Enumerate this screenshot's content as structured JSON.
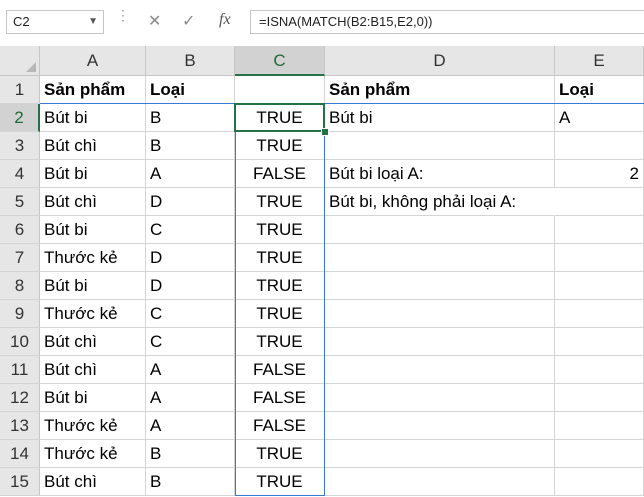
{
  "formula_bar": {
    "name_box": "C2",
    "cancel_icon": "cancel-icon",
    "enter_icon": "checkmark-icon",
    "fx_label": "fx",
    "formula": "=ISNA(MATCH(B2:B15,E2,0))"
  },
  "columns": [
    "A",
    "B",
    "C",
    "D",
    "E"
  ],
  "rows": [
    "1",
    "2",
    "3",
    "4",
    "5",
    "6",
    "7",
    "8",
    "9",
    "10",
    "11",
    "12",
    "13",
    "14",
    "15"
  ],
  "cells": {
    "A1": "Sản phẩm",
    "B1": "Loại",
    "C1": "",
    "D1": "Sản phẩm",
    "E1": "Loại",
    "A2": "Bút bi",
    "B2": "B",
    "C2": "TRUE",
    "D2": "Bút bi",
    "E2": "A",
    "A3": "Bút chì",
    "B3": "B",
    "C3": "TRUE",
    "D3": "",
    "E3": "",
    "A4": "Bút bi",
    "B4": "A",
    "C4": "FALSE",
    "D4": "Bút bi loại A:",
    "E4": "2",
    "A5": "Bút chì",
    "B5": "D",
    "C5": "TRUE",
    "D5": "Bút bi, không phải loại A:",
    "E5": "",
    "A6": "Bút bi",
    "B6": "C",
    "C6": "TRUE",
    "D6": "",
    "E6": "",
    "A7": "Thước kẻ",
    "B7": "D",
    "C7": "TRUE",
    "D7": "",
    "E7": "",
    "A8": "Bút bi",
    "B8": "D",
    "C8": "TRUE",
    "D8": "",
    "E8": "",
    "A9": "Thước kẻ",
    "B9": "C",
    "C9": "TRUE",
    "D9": "",
    "E9": "",
    "A10": "Bút chì",
    "B10": "C",
    "C10": "TRUE",
    "D10": "",
    "E10": "",
    "A11": "Bút chì",
    "B11": "A",
    "C11": "FALSE",
    "D11": "",
    "E11": "",
    "A12": "Bút bi",
    "B12": "A",
    "C12": "FALSE",
    "D12": "",
    "E12": "",
    "A13": "Thước kẻ",
    "B13": "A",
    "C13": "FALSE",
    "D13": "",
    "E13": "",
    "A14": "Thước kẻ",
    "B14": "B",
    "C14": "TRUE",
    "D14": "",
    "E14": "",
    "A15": "Bút chì",
    "B15": "B",
    "C15": "TRUE",
    "D15": "",
    "E15": ""
  },
  "selection": {
    "active_cell": "C2",
    "selected_range": "C2:C15",
    "accent_color": "#217346",
    "range_color": "#3a78d6"
  }
}
